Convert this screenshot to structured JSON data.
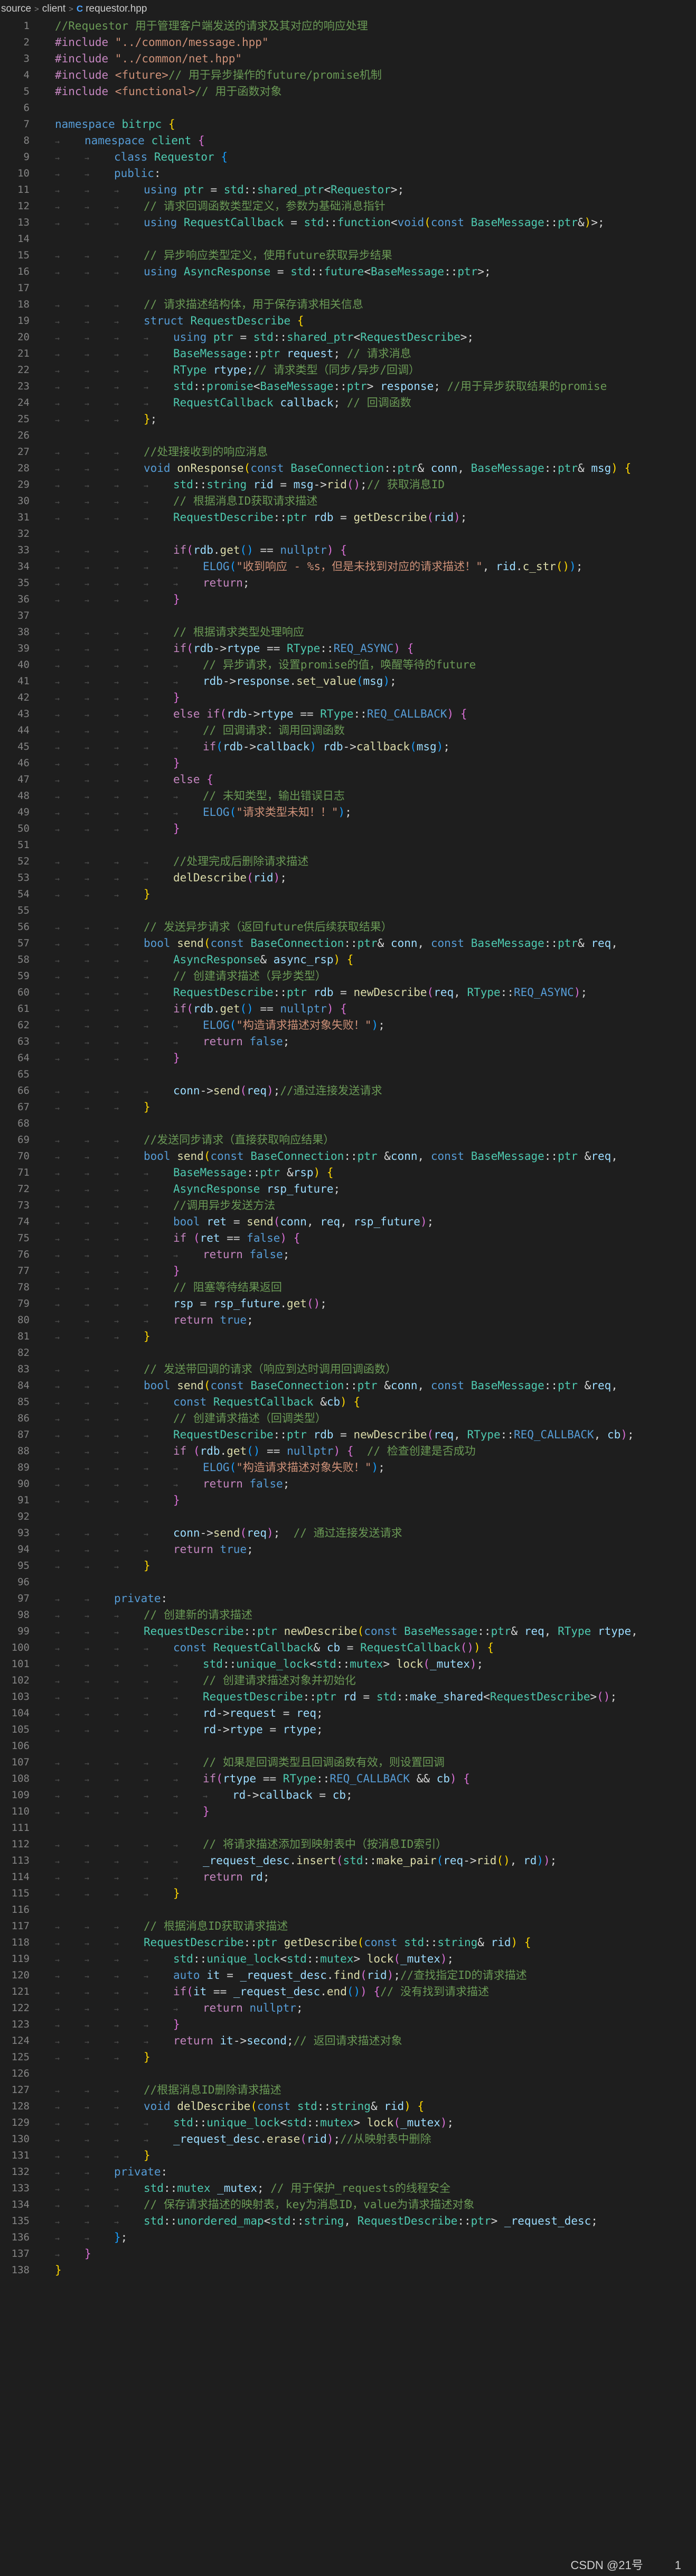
{
  "breadcrumb": {
    "items": [
      "source",
      "client",
      "requestor.hpp"
    ],
    "file_icon": "C"
  },
  "footer": {
    "watermark": "CSDN @21号",
    "page": "1"
  },
  "code_lines": [
    "//Requestor 用于管理客户端发送的请求及其对应的响应处理",
    "#include \"../common/message.hpp\"",
    "#include \"../common/net.hpp\"",
    "#include <future>// 用于异步操作的future/promise机制",
    "#include <functional>// 用于函数对象",
    "",
    "namespace bitrpc {",
    "    namespace client {",
    "        class Requestor {",
    "        public:",
    "            using ptr = std::shared_ptr<Requestor>;",
    "            // 请求回调函数类型定义，参数为基础消息指针",
    "            using RequestCallback = std::function<void(const BaseMessage::ptr&)>;",
    "",
    "            // 异步响应类型定义，使用future获取异步结果",
    "            using AsyncResponse = std::future<BaseMessage::ptr>;",
    "",
    "            // 请求描述结构体，用于保存请求相关信息",
    "            struct RequestDescribe {",
    "                using ptr = std::shared_ptr<RequestDescribe>;",
    "                BaseMessage::ptr request; // 请求消息",
    "                RType rtype;// 请求类型（同步/异步/回调）",
    "                std::promise<BaseMessage::ptr> response; //用于异步获取结果的promise",
    "                RequestCallback callback; // 回调函数",
    "            };",
    "",
    "            //处理接收到的响应消息",
    "            void onResponse(const BaseConnection::ptr& conn, BaseMessage::ptr& msg) {",
    "                std::string rid = msg->rid();// 获取消息ID",
    "                // 根据消息ID获取请求描述",
    "                RequestDescribe::ptr rdb = getDescribe(rid);",
    "",
    "                if(rdb.get() == nullptr) {",
    "                    ELOG(\"收到响应 - %s，但是未找到对应的请求描述！\", rid.c_str());",
    "                    return;",
    "                }",
    "",
    "                // 根据请求类型处理响应",
    "                if(rdb->rtype == RType::REQ_ASYNC) {",
    "                    // 异步请求，设置promise的值，唤醒等待的future",
    "                    rdb->response.set_value(msg);",
    "                }",
    "                else if(rdb->rtype == RType::REQ_CALLBACK) {",
    "                    // 回调请求：调用回调函数",
    "                    if(rdb->callback) rdb->callback(msg);",
    "                }",
    "                else {",
    "                    // 未知类型，输出错误日志",
    "                    ELOG(\"请求类型未知！！\");",
    "                }",
    "",
    "                //处理完成后删除请求描述",
    "                delDescribe(rid);",
    "            }",
    "",
    "            // 发送异步请求（返回future供后续获取结果）",
    "            bool send(const BaseConnection::ptr& conn, const BaseMessage::ptr& req,",
    "                AsyncResponse& async_rsp) {",
    "                // 创建请求描述（异步类型）",
    "                RequestDescribe::ptr rdb = newDescribe(req, RType::REQ_ASYNC);",
    "                if(rdb.get() == nullptr) {",
    "                    ELOG(\"构造请求描述对象失败！\");",
    "                    return false;",
    "                }",
    "",
    "                conn->send(req);//通过连接发送请求",
    "            }",
    "",
    "            //发送同步请求（直接获取响应结果）",
    "            bool send(const BaseConnection::ptr &conn, const BaseMessage::ptr &req,",
    "                BaseMessage::ptr &rsp) {",
    "                AsyncResponse rsp_future;",
    "                //调用异步发送方法",
    "                bool ret = send(conn, req, rsp_future);",
    "                if (ret == false) {",
    "                    return false;",
    "                }",
    "                // 阻塞等待结果返回",
    "                rsp = rsp_future.get();",
    "                return true;",
    "            }",
    "",
    "            // 发送带回调的请求（响应到达时调用回调函数）",
    "            bool send(const BaseConnection::ptr &conn, const BaseMessage::ptr &req,",
    "                const RequestCallback &cb) {",
    "                // 创建请求描述（回调类型）",
    "                RequestDescribe::ptr rdb = newDescribe(req, RType::REQ_CALLBACK, cb);",
    "                if (rdb.get() == nullptr) {  // 检查创建是否成功",
    "                    ELOG(\"构造请求描述对象失败！\");",
    "                    return false;",
    "                }",
    "",
    "                conn->send(req);  // 通过连接发送请求",
    "                return true;",
    "            }",
    "",
    "        private:",
    "            // 创建新的请求描述",
    "            RequestDescribe::ptr newDescribe(const BaseMessage::ptr& req, RType rtype,",
    "                const RequestCallback& cb = RequestCallback()) {",
    "                    std::unique_lock<std::mutex> lock(_mutex);",
    "                    // 创建请求描述对象并初始化",
    "                    RequestDescribe::ptr rd = std::make_shared<RequestDescribe>();",
    "                    rd->request = req;",
    "                    rd->rtype = rtype;",
    "",
    "                    // 如果是回调类型且回调函数有效，则设置回调",
    "                    if(rtype == RType::REQ_CALLBACK && cb) {",
    "                        rd->callback = cb;",
    "                    }",
    "",
    "                    // 将请求描述添加到映射表中（按消息ID索引）",
    "                    _request_desc.insert(std::make_pair(req->rid(), rd));",
    "                    return rd;",
    "                }",
    "",
    "            // 根据消息ID获取请求描述",
    "            RequestDescribe::ptr getDescribe(const std::string& rid) {",
    "                std::unique_lock<std::mutex> lock(_mutex);",
    "                auto it = _request_desc.find(rid);//查找指定ID的请求描述",
    "                if(it == _request_desc.end()) {// 没有找到请求描述",
    "                    return nullptr;",
    "                }",
    "                return it->second;// 返回请求描述对象",
    "            }",
    "",
    "            //根据消息ID删除请求描述",
    "            void delDescribe(const std::string& rid) {",
    "                std::unique_lock<std::mutex> lock(_mutex);",
    "                _request_desc.erase(rid);//从映射表中删除",
    "            }",
    "        private:",
    "            std::mutex _mutex; // 用于保护_requests的线程安全",
    "            // 保存请求描述的映射表，key为消息ID，value为请求描述对象",
    "            std::unordered_map<std::string, RequestDescribe::ptr> _request_desc;",
    "        };",
    "    }",
    "}"
  ]
}
